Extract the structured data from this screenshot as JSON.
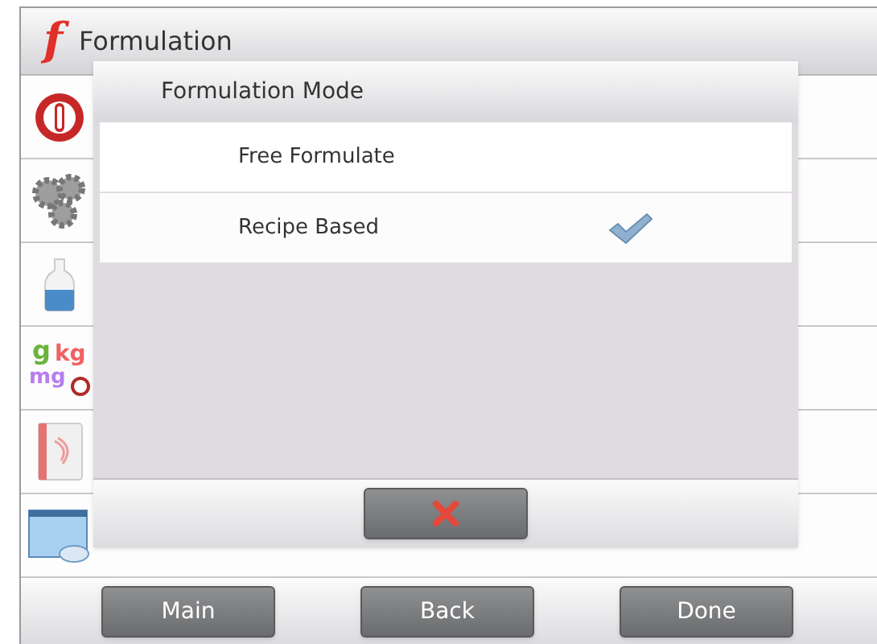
{
  "header": {
    "logo_glyph": "f",
    "title": "Formulation"
  },
  "sidebar": {
    "items": [
      {
        "kind": "power"
      },
      {
        "kind": "gears"
      },
      {
        "kind": "bottle"
      },
      {
        "kind": "units",
        "glyphs": [
          "g",
          "kg",
          "mg"
        ]
      },
      {
        "kind": "book"
      },
      {
        "kind": "print"
      }
    ]
  },
  "dialog": {
    "title": "Formulation Mode",
    "options": [
      {
        "label": "Free Formulate",
        "selected": false
      },
      {
        "label": "Recipe Based",
        "selected": true
      }
    ]
  },
  "bottom_bar": {
    "buttons": [
      "Main",
      "Back",
      "Done"
    ]
  }
}
